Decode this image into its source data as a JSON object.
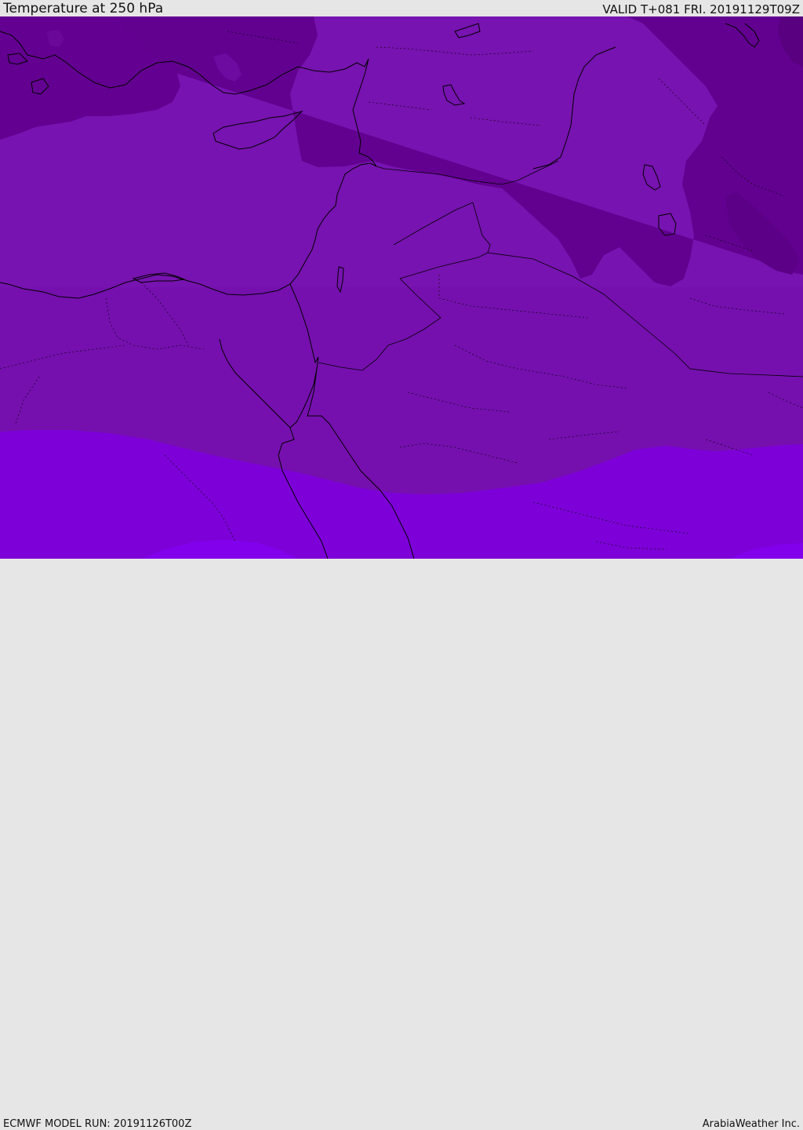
{
  "header": {
    "title": "Temperature at 250 hPa",
    "valid": "VALID T+081 FRI. 20191129T09Z"
  },
  "footer": {
    "model_run": "ECMWF MODEL RUN: 20191126T00Z",
    "credit": "ArabiaWeather Inc."
  },
  "colors": {
    "darkest": "#58007f",
    "dark": "#620090",
    "mid": "#7212aa",
    "mid_base": "#7510ae",
    "light": "#7d00d8",
    "lightest": "#8200ec",
    "lines": "#000000"
  }
}
